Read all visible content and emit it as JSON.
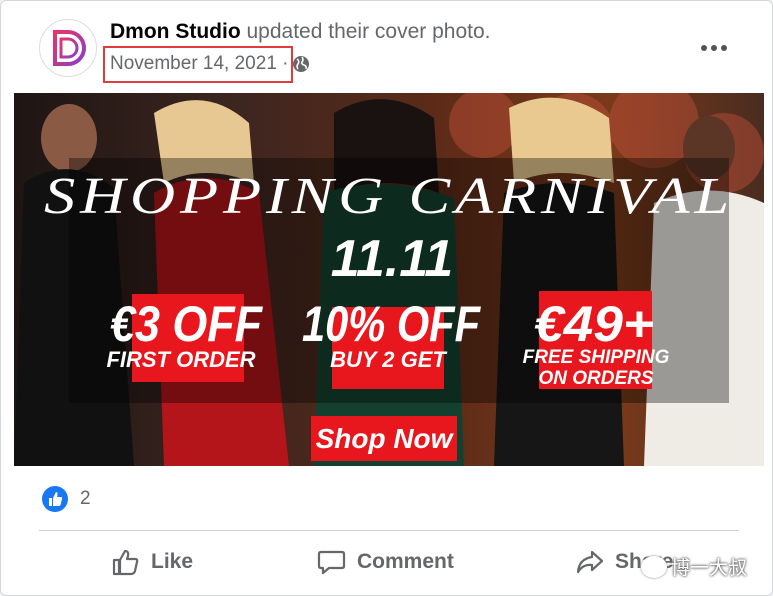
{
  "post": {
    "page_name": "Dmon Studio",
    "action_text": "updated their cover photo.",
    "date": "November 14, 2021",
    "separator": "·"
  },
  "banner": {
    "headline": "SHOPPING CARNIVAL",
    "event": "11.11",
    "offers": [
      {
        "big": "€3 OFF",
        "small": "FIRST ORDER"
      },
      {
        "big": "10% OFF",
        "small": "BUY 2 GET"
      },
      {
        "big": "€49+",
        "small_1": "FREE SHIPPING",
        "small_2": "ON ORDERS"
      }
    ],
    "cta": "Shop Now"
  },
  "reactions": {
    "count": "2"
  },
  "actions": {
    "like": "Like",
    "comment": "Comment",
    "share": "Share"
  },
  "watermark": "博一大叔",
  "colors": {
    "brand_red": "#e8171e",
    "facebook_blue": "#1877f2",
    "highlight_box": "#e03c3c"
  },
  "icons": [
    "globe-icon",
    "more-options-icon",
    "like-reaction-icon",
    "thumbs-up-icon",
    "comment-icon",
    "share-icon"
  ]
}
